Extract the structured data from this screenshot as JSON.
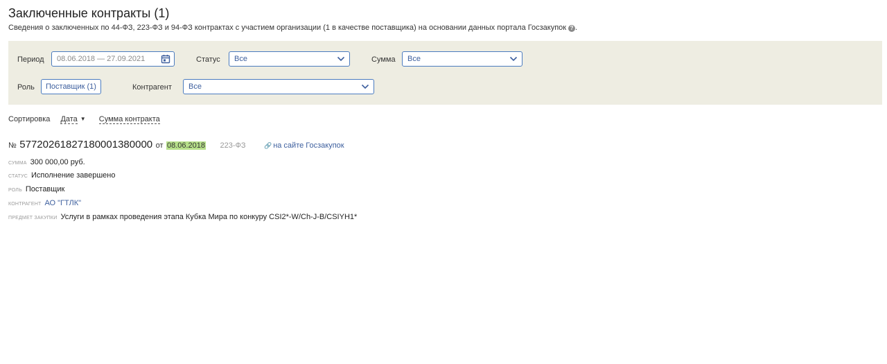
{
  "header": {
    "title": "Заключенные контракты (1)",
    "subtitle": "Сведения о заключенных по 44-ФЗ, 223-ФЗ и 94-ФЗ контрактах с участием организации (1 в качестве поставщика) на основании данных портала Госзакупок",
    "help_icon": "question-circle-icon"
  },
  "filters": {
    "period_label": "Период",
    "period_value": "08.06.2018 — 27.09.2021",
    "status_label": "Статус",
    "status_value": "Все",
    "sum_label": "Сумма",
    "sum_value": "Все",
    "role_label": "Роль",
    "role_value": "Поставщик (1)",
    "counterparty_label": "Контрагент",
    "counterparty_value": "Все"
  },
  "sort": {
    "label": "Сортировка",
    "by_date": "Дата",
    "by_sum": "Сумма контракта"
  },
  "contract": {
    "number_prefix": "№",
    "number": "57720261827180001380000",
    "from_label": "от",
    "date": "08.06.2018",
    "law": "223-ФЗ",
    "site_link": "на сайте Госзакупок",
    "sum_label": "сумма",
    "sum_value": "300 000,00 руб.",
    "status_label": "статус",
    "status_value": "Исполнение завершено",
    "role_label": "роль",
    "role_value": "Поставщик",
    "counterparty_label": "контрагент",
    "counterparty_value": "АО \"ГТЛК\"",
    "subject_label": "предмет закупки",
    "subject_value": "Услуги в рамках проведения этапа Кубка Мира по конкуру CSI2*-W/Ch-J-B/CSIYH1*"
  },
  "colors": {
    "accent": "#4a7bbf",
    "link": "#3d5f9e",
    "panel_bg": "#eeede2",
    "date_highlight": "#b7e08a"
  }
}
